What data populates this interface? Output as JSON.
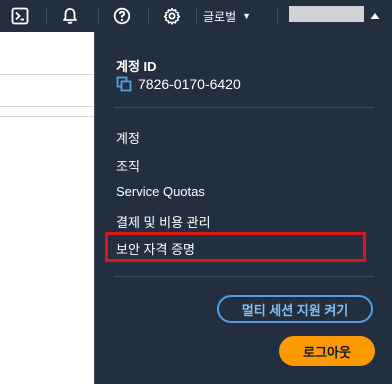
{
  "nav": {
    "icons": [
      "cloudshell-icon",
      "bell-icon",
      "help-icon",
      "gear-icon"
    ],
    "region_label": "글로벌",
    "region_caret": "▼"
  },
  "account_menu": {
    "account_id_label": "계정 ID",
    "account_id": "7826-0170-6420",
    "items": [
      "계정",
      "조직",
      "Service Quotas",
      "결제 및 비용 관리",
      "보안 자격 증명"
    ],
    "multi_session_label": "멀티 세션 지원 켜기",
    "logout_label": "로그아웃"
  },
  "colors": {
    "nav_bg": "#232f3e",
    "highlight": "#d91515",
    "primary_button": "#ff9900",
    "link_blue": "#539fe5"
  }
}
